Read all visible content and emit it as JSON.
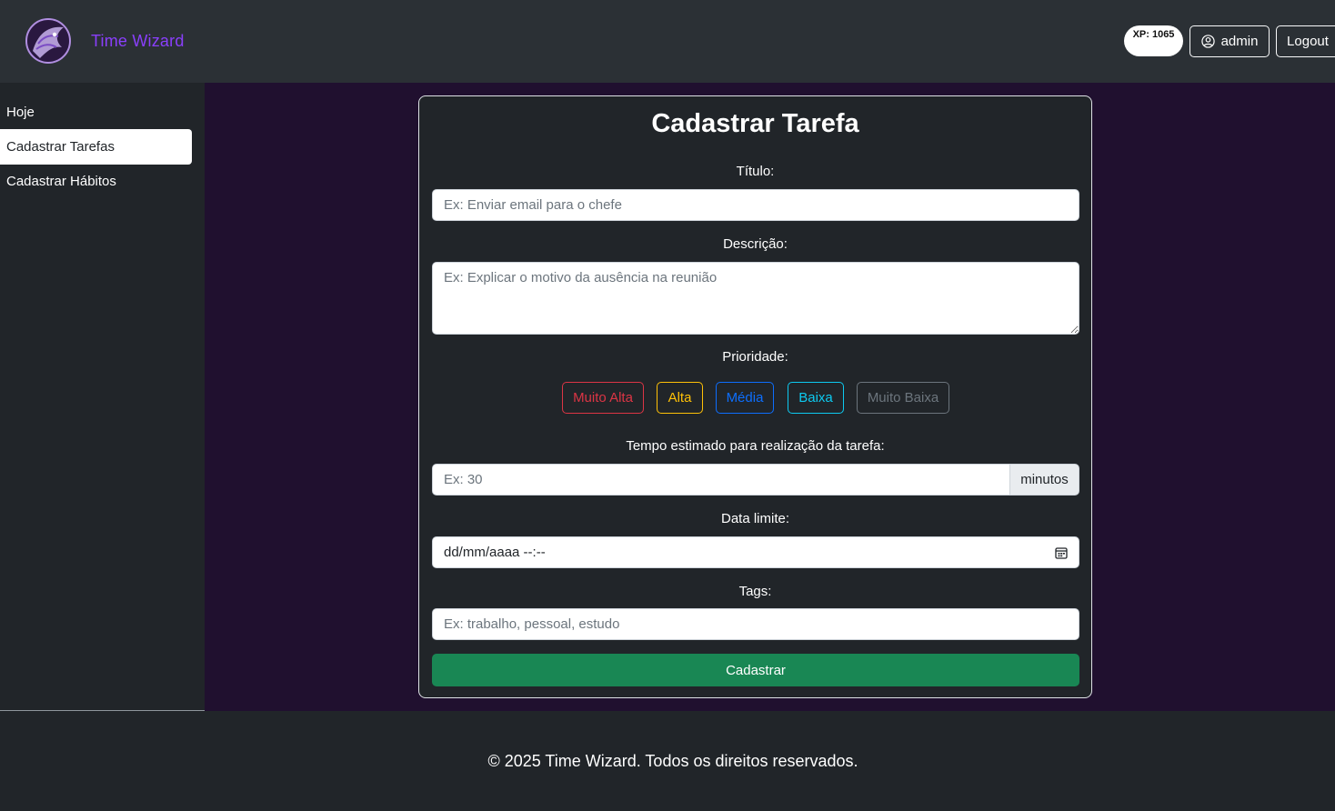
{
  "header": {
    "brand_name": "Time Wizard",
    "logo_icon": "wizard-logo-icon",
    "xp_label": "XP: 1065",
    "user_label": "admin",
    "user_icon": "person-circle-icon",
    "logout_label": "Logout"
  },
  "sidebar": {
    "items": [
      {
        "label": "Hoje",
        "active": false
      },
      {
        "label": "Cadastrar Tarefas",
        "active": true
      },
      {
        "label": "Cadastrar Hábitos",
        "active": false
      }
    ]
  },
  "form": {
    "title": "Cadastrar Tarefa",
    "titulo_label": "Título:",
    "titulo_placeholder": "Ex: Enviar email para o chefe",
    "descricao_label": "Descrição:",
    "descricao_placeholder": "Ex: Explicar o motivo da ausência na reunião",
    "prioridade_label": "Prioridade:",
    "priorities": [
      {
        "label": "Muito Alta",
        "color": "#dc3545"
      },
      {
        "label": "Alta",
        "color": "#ffc107"
      },
      {
        "label": "Média",
        "color": "#0d6efd"
      },
      {
        "label": "Baixa",
        "color": "#0dcaf0"
      },
      {
        "label": "Muito Baixa",
        "color": "#6c757d"
      }
    ],
    "tempo_label": "Tempo estimado para realização da tarefa:",
    "tempo_placeholder": "Ex: 30",
    "tempo_unit": "minutos",
    "data_label": "Data limite:",
    "data_value": "dd/mm/aaaa --:--",
    "calendar_icon": "calendar-icon",
    "tags_label": "Tags:",
    "tags_placeholder": "Ex: trabalho, pessoal, estudo",
    "submit_label": "Cadastrar"
  },
  "footer": {
    "text": "© 2025 Time Wizard. Todos os direitos reservados."
  },
  "colors": {
    "brand": "#8a3ffc",
    "header_bg": "#2b3035",
    "main_bg": "#20102f",
    "submit_bg": "#198754"
  }
}
